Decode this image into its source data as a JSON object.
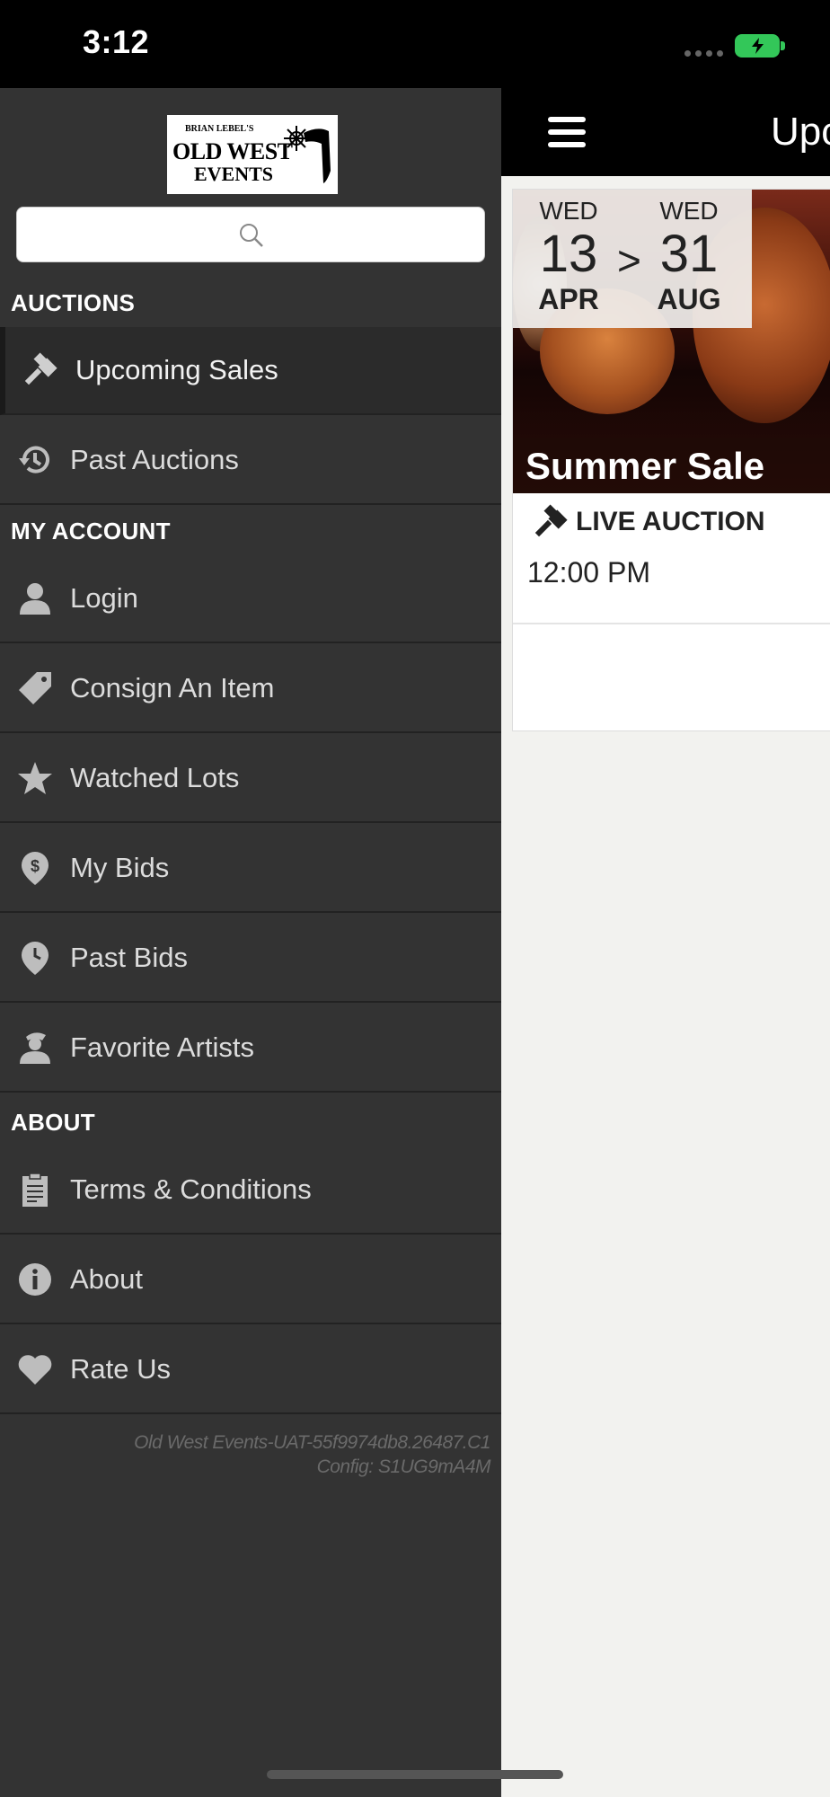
{
  "status_bar": {
    "time": "3:12"
  },
  "main": {
    "title": "Upcoming Sales",
    "sale": {
      "start_day": "WED",
      "start_date": "13",
      "start_month": "APR",
      "separator": ">",
      "end_day": "WED",
      "end_date": "31",
      "end_month": "AUG",
      "name": "Summer Sale",
      "type": "LIVE AUCTION",
      "time": "12:00 PM"
    }
  },
  "drawer": {
    "logo": {
      "line1": "BRIAN LEBEL'S",
      "line2": "OLD WEST",
      "line3": "EVENTS"
    },
    "search_placeholder": "",
    "sections": {
      "auctions": "AUCTIONS",
      "my_account": "MY ACCOUNT",
      "about": "ABOUT"
    },
    "items": [
      {
        "label": "Upcoming Sales",
        "icon": "gavel-icon"
      },
      {
        "label": "Past Auctions",
        "icon": "history-icon"
      },
      {
        "label": "Login",
        "icon": "user-icon"
      },
      {
        "label": "Consign An Item",
        "icon": "tag-icon"
      },
      {
        "label": "Watched Lots",
        "icon": "star-icon"
      },
      {
        "label": "My Bids",
        "icon": "dollar-pin-icon"
      },
      {
        "label": "Past Bids",
        "icon": "clock-pin-icon"
      },
      {
        "label": "Favorite Artists",
        "icon": "artist-icon"
      },
      {
        "label": "Terms & Conditions",
        "icon": "clipboard-icon"
      },
      {
        "label": "About",
        "icon": "info-icon"
      },
      {
        "label": "Rate Us",
        "icon": "heart-icon"
      }
    ],
    "version_line1": "Old West Events-UAT-55f9974db8.26487.C1",
    "version_line2": "Config: S1UG9mA4M"
  },
  "colors": {
    "drawer_bg": "#333333",
    "active_bg": "#2b2b2b",
    "battery": "#33c759",
    "content_bg": "#f2f2ef"
  }
}
